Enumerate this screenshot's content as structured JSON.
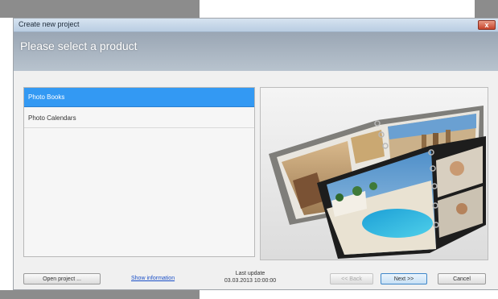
{
  "window": {
    "title": "Create new project",
    "close_label": "x",
    "heading": "Please select a product"
  },
  "products": {
    "items": [
      {
        "label": "Photo Books",
        "selected": true
      },
      {
        "label": "Photo Calendars",
        "selected": false
      }
    ]
  },
  "footer": {
    "open_project_label": "Open project ...",
    "show_information_label": "Show information",
    "last_update_label": "Last update",
    "last_update_date": "03.03.2013 10:00:00",
    "back_label": "<< Back",
    "next_label": "Next >>",
    "cancel_label": "Cancel"
  },
  "colors": {
    "selection": "#3399f3",
    "header": "#a9b4c0",
    "close_button": "#c6442c"
  }
}
